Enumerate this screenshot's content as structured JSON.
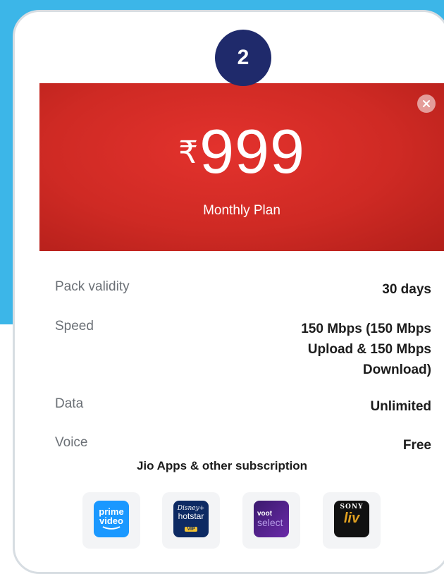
{
  "step_number": "2",
  "plan": {
    "currency_symbol": "₹",
    "price": "999",
    "name": "Monthly Plan"
  },
  "details": [
    {
      "label": "Pack validity",
      "value": "30 days"
    },
    {
      "label": "Speed",
      "value": "150 Mbps (150 Mbps Upload & 150 Mbps Download)"
    },
    {
      "label": "Data",
      "value": "Unlimited"
    },
    {
      "label": "Voice",
      "value": "Free"
    }
  ],
  "subscriptions": {
    "title": "Jio Apps & other subscription",
    "apps": [
      {
        "name": "prime video",
        "logo_line1": "prime",
        "logo_line2": "video"
      },
      {
        "name": "Disney+ Hotstar VIP",
        "logo_line1": "Disney+",
        "logo_line2": "hotstar",
        "badge": "VIP"
      },
      {
        "name": "Voot Select",
        "logo_line1": "voot",
        "logo_line2": "select"
      },
      {
        "name": "Sony LIV",
        "logo_line1": "SONY",
        "logo_line2": "liv"
      }
    ]
  },
  "colors": {
    "background_blue": "#3cb6e8",
    "badge_navy": "#1f2a6b",
    "hero_red": "#d62c26"
  }
}
